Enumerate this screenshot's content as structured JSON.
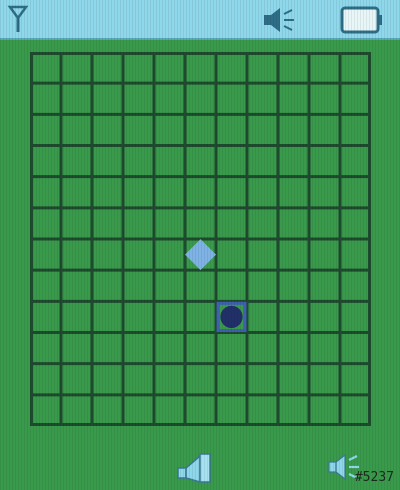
{
  "game": {
    "name": "board-game",
    "grid": {
      "columns": 11,
      "rows": 12
    },
    "pieces": [
      {
        "type": "diamond",
        "color": "light-blue",
        "column": 5,
        "row": 6,
        "selected": false
      },
      {
        "type": "stone",
        "color": "dark-blue",
        "column": 6,
        "row": 8,
        "selected": true
      }
    ]
  },
  "status_bar": {
    "icons": [
      "signal-antenna-icon",
      "speaker-volume-icon",
      "battery-icon"
    ]
  },
  "softkeys": {
    "left": "speaker-softkey-icon",
    "right": "speaker-volume-icon"
  },
  "watermark": "#5237",
  "colors": {
    "board_bg": "#3a9a4c",
    "grid_line": "#1e4a2e",
    "status_bar": "#8fd7ea",
    "piece_light": "#7fb3e6",
    "piece_dark": "#22306a",
    "cursor": "#3f5fb0"
  }
}
